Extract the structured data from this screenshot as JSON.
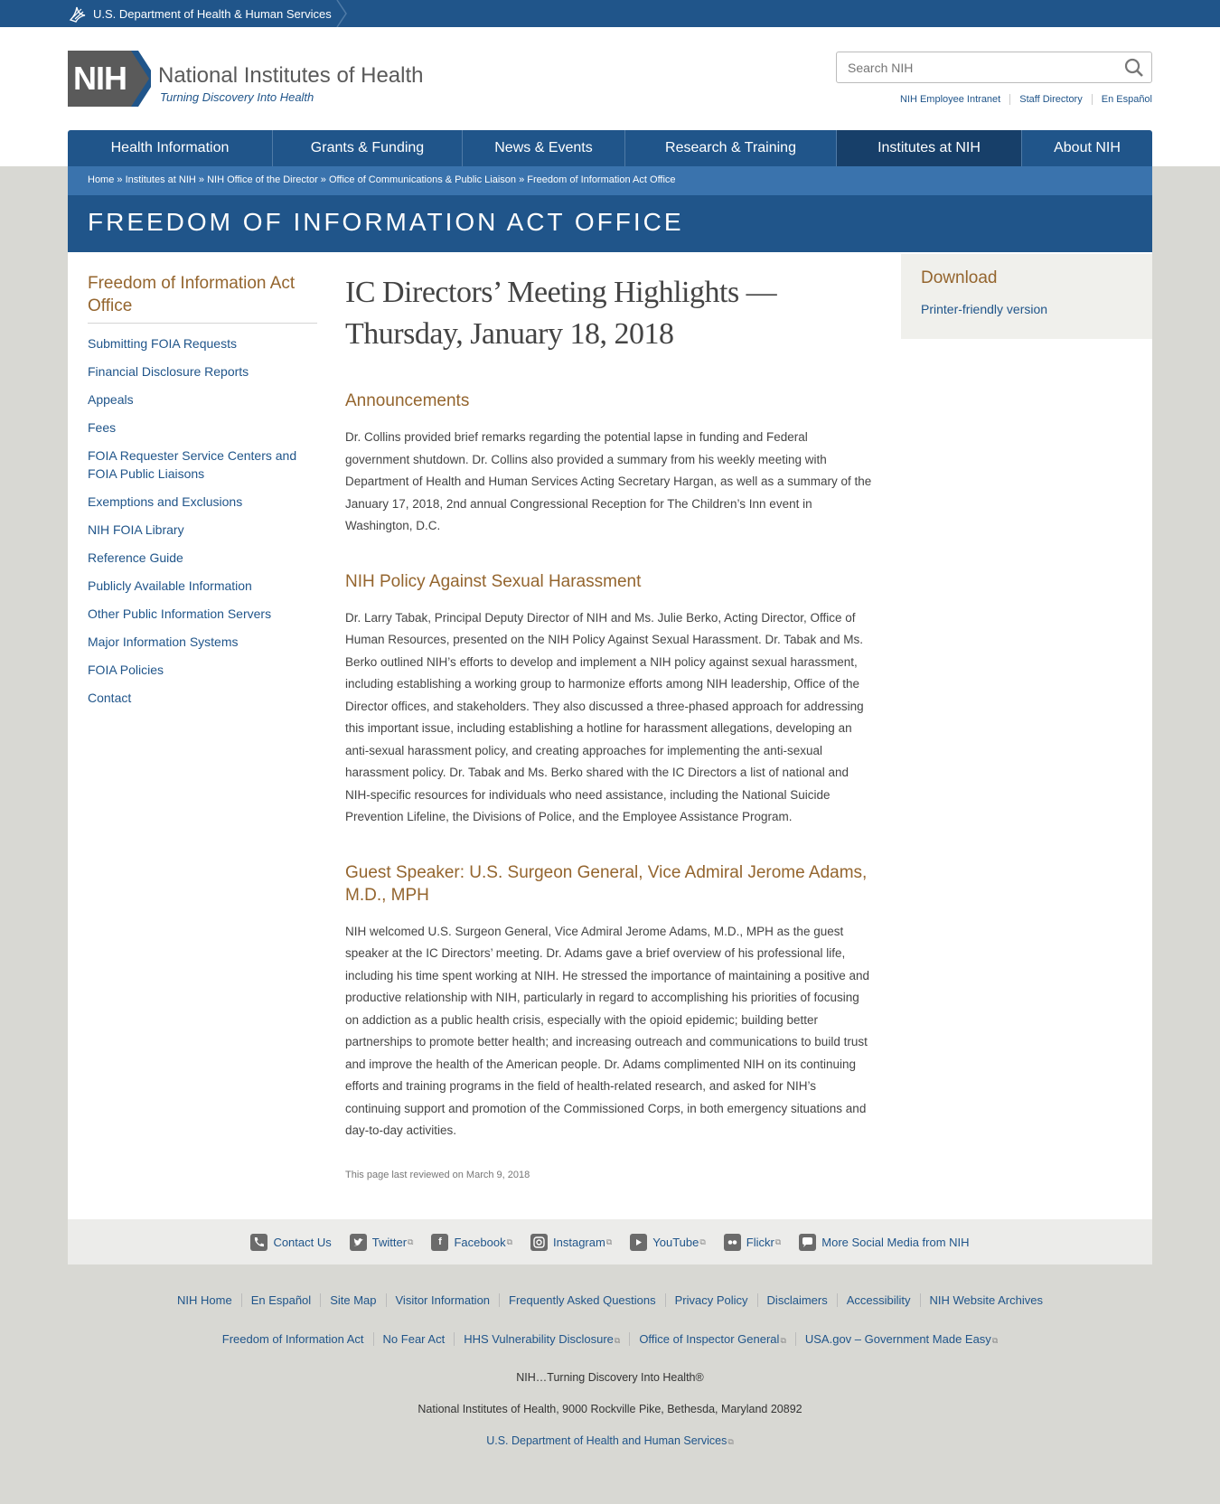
{
  "hhs": {
    "label": "U.S. Department of Health & Human Services"
  },
  "logo": {
    "abbr": "NIH",
    "name": "National Institutes of Health",
    "tagline": "Turning Discovery Into Health"
  },
  "search": {
    "placeholder": "Search NIH"
  },
  "util_links": [
    "NIH Employee Intranet",
    "Staff Directory",
    "En Español"
  ],
  "nav": [
    {
      "label": "Health Information"
    },
    {
      "label": "Grants & Funding"
    },
    {
      "label": "News & Events"
    },
    {
      "label": "Research & Training"
    },
    {
      "label": "Institutes at NIH"
    },
    {
      "label": "About NIH"
    }
  ],
  "breadcrumb": [
    "Home",
    "Institutes at NIH",
    "NIH Office of the Director",
    "Office of Communications & Public Liaison",
    "Freedom of Information Act Office"
  ],
  "breadcrumb_sep": " » ",
  "section_title": "FREEDOM OF INFORMATION ACT OFFICE",
  "sidebar": {
    "title": "Freedom of Information Act Office",
    "items": [
      "Submitting FOIA Requests",
      "Financial Disclosure Reports",
      "Appeals",
      "Fees",
      "FOIA Requester Service Centers and FOIA Public Liaisons",
      "Exemptions and Exclusions",
      "NIH FOIA Library",
      "Reference Guide",
      "Publicly Available Information",
      "Other Public Information Servers",
      "Major Information Systems",
      "FOIA Policies",
      "Contact"
    ]
  },
  "article": {
    "title": "IC Directors’ Meeting Highlights — Thursday, January 18, 2018",
    "sections": [
      {
        "heading": "Announcements",
        "body": "Dr. Collins provided brief remarks regarding the potential lapse in funding and Federal government shutdown.  Dr. Collins also provided a summary from his weekly meeting with Department of Health and Human Services Acting Secretary Hargan, as well as a summary of the January 17, 2018, 2nd annual Congressional Reception for The Children’s Inn event in Washington, D.C."
      },
      {
        "heading": "NIH Policy Against Sexual Harassment",
        "body": "Dr. Larry Tabak, Principal Deputy Director of NIH and Ms. Julie Berko, Acting Director, Office of Human Resources, presented on the NIH Policy Against Sexual Harassment.  Dr. Tabak and Ms. Berko outlined NIH’s efforts to develop and implement a NIH policy against sexual harassment, including establishing a working group to harmonize efforts among NIH leadership, Office of the Director offices, and stakeholders.  They also discussed a three-phased approach for addressing this important issue, including establishing a hotline for harassment allegations, developing an anti-sexual harassment policy, and creating approaches for implementing the anti-sexual harassment policy.  Dr. Tabak and Ms. Berko shared with the IC Directors a list of national and NIH-specific resources for individuals who need assistance, including the National Suicide Prevention Lifeline, the Divisions of Police, and the Employee Assistance Program."
      },
      {
        "heading": "Guest Speaker:  U.S. Surgeon General, Vice Admiral Jerome Adams, M.D., MPH",
        "body": "NIH welcomed U.S. Surgeon General, Vice Admiral Jerome Adams, M.D., MPH as the guest speaker at the IC Directors’ meeting.  Dr. Adams gave a brief overview of his professional life, including his time spent working at NIH.  He stressed the importance of maintaining a positive and productive relationship with NIH, particularly in regard to accomplishing his priorities of focusing on addiction as a public health crisis, especially with the opioid epidemic; building better partnerships to promote better health; and increasing outreach and communications to build trust and improve the health of the American people.  Dr. Adams complimented NIH on its continuing efforts and training programs in the field of health-related research, and asked for NIH’s continuing support and promotion of the Commissioned Corps, in both emergency situations and day-to-day activities."
      }
    ],
    "reviewed": "This page last reviewed on March 9, 2018"
  },
  "download": {
    "title": "Download",
    "link": "Printer-friendly version"
  },
  "social": [
    {
      "label": "Contact Us",
      "icon": "phone-icon",
      "external": false
    },
    {
      "label": "Twitter",
      "icon": "twitter-icon",
      "external": true
    },
    {
      "label": "Facebook",
      "icon": "facebook-icon",
      "external": true
    },
    {
      "label": "Instagram",
      "icon": "instagram-icon",
      "external": true
    },
    {
      "label": "YouTube",
      "icon": "youtube-icon",
      "external": true
    },
    {
      "label": "Flickr",
      "icon": "flickr-icon",
      "external": true
    },
    {
      "label": "More Social Media from NIH",
      "icon": "chat-icon",
      "external": false
    }
  ],
  "footer_links_1": [
    "NIH Home",
    "En Español",
    "Site Map",
    "Visitor Information",
    "Frequently Asked Questions",
    "Privacy Policy",
    "Disclaimers",
    "Accessibility",
    "NIH Website Archives"
  ],
  "footer_links_2": [
    {
      "label": "Freedom of Information Act",
      "external": false
    },
    {
      "label": "No Fear Act",
      "external": false
    },
    {
      "label": "HHS Vulnerability Disclosure",
      "external": true
    },
    {
      "label": "Office of Inspector General",
      "external": true
    },
    {
      "label": "USA.gov – Government Made Easy",
      "external": true
    }
  ],
  "footer_tagline": "NIH…Turning Discovery Into Health®",
  "footer_address": "National Institutes of Health, 9000 Rockville Pike, Bethesda, Maryland 20892",
  "footer_hhs": "U.S. Department of Health and Human Services",
  "colors": {
    "primary": "#20558a",
    "accent": "#94652e",
    "nav_active": "#173f69",
    "breadcrumb": "#3a73ad"
  }
}
